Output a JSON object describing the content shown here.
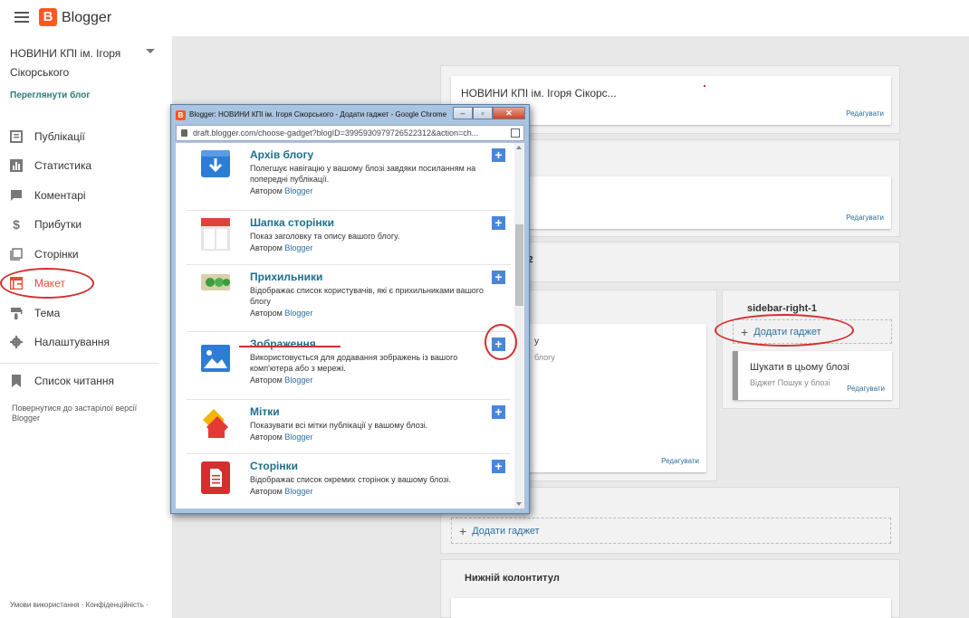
{
  "app": {
    "brand": "Blogger",
    "logo_letter": "B"
  },
  "sidebar": {
    "blog_name": "НОВИНИ КПІ ім. Ігоря Сікорського",
    "view_blog": "Переглянути блог",
    "items": [
      {
        "label": "Публікації",
        "icon": "posts-icon"
      },
      {
        "label": "Статистика",
        "icon": "stats-icon"
      },
      {
        "label": "Коментарі",
        "icon": "comments-icon"
      },
      {
        "label": "Прибутки",
        "icon": "earnings-icon"
      },
      {
        "label": "Сторінки",
        "icon": "pages-icon"
      },
      {
        "label": "Макет",
        "icon": "layout-icon"
      },
      {
        "label": "Тема",
        "icon": "theme-icon"
      },
      {
        "label": "Налаштування",
        "icon": "gear-icon"
      }
    ],
    "reading_list": "Список читання",
    "old_version": "Повернутися до застарілої версії Blogger",
    "footer_terms": "Умови використання",
    "footer_privacy": "Конфіденційність"
  },
  "layout": {
    "header_card_title": "НОВИНИ КПІ ім. Ігоря Сікорс...",
    "edit_label": "Редагувати",
    "add_gadget": "Додати гаджет",
    "sidebar_right_label": "sidebar-right-1",
    "search_card_title": "Шукати в цьому блозі",
    "search_card_sub": "Віджет Пошук у блозі",
    "partial_label_2": "2",
    "partial_text_1": "у",
    "partial_text_2": "блогу",
    "footer_section": "Нижній колонтитул"
  },
  "popup": {
    "window_title": "Blogger: НОВИНИ КПІ ім. Ігоря Сікорського - Додати гаджет - Google Chrome",
    "url": "draft.blogger.com/choose-gadget?blogID=3995930979726522312&action=ch...",
    "author_prefix": "Автором",
    "author_name": "Blogger",
    "gadgets": [
      {
        "name": "Архів блогу",
        "desc": "Полегшує навігацію у вашому блозі завдяки посиланням на попередні публікації.",
        "icon": "archive-icon"
      },
      {
        "name": "Шапка сторінки",
        "desc": "Показ заголовку та опису вашого блогу.",
        "icon": "header-icon"
      },
      {
        "name": "Прихильники",
        "desc": "Відображає список користувачів, які є прихильниками вашого блогу",
        "icon": "followers-icon"
      },
      {
        "name": "Зображення",
        "desc": "Використовується для додавання зображень із вашого комп'ютера або з мережі.",
        "icon": "image-icon"
      },
      {
        "name": "Мітки",
        "desc": "Показувати всі мітки публікації у вашому блозі.",
        "icon": "labels-icon"
      },
      {
        "name": "Сторінки",
        "desc": "Відображає список окремих сторінок у вашому блозі.",
        "icon": "pages-gadget-icon"
      }
    ]
  },
  "colors": {
    "accent": "#ff5722",
    "link": "#2b6fa0",
    "annotation": "#d32f2f",
    "add_button": "#4a86d8"
  }
}
